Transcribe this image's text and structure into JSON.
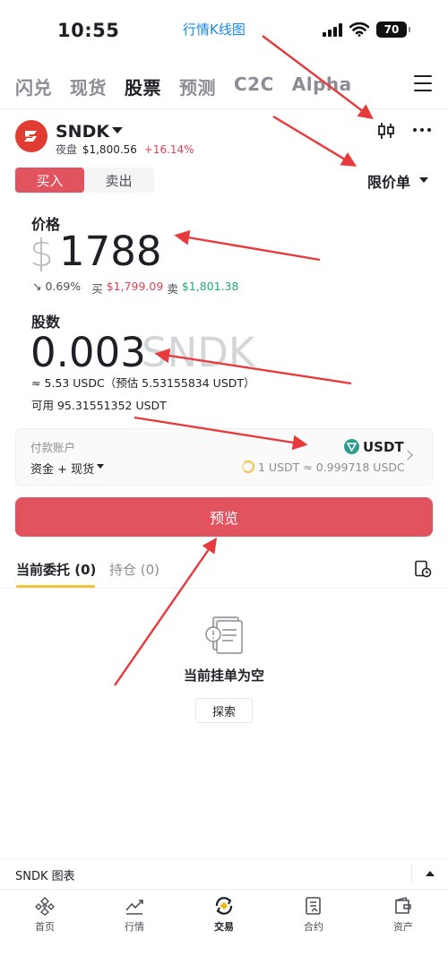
{
  "status": {
    "time": "10:55",
    "battery": "70"
  },
  "annotation": {
    "label": "行情K线图"
  },
  "top_tabs": [
    {
      "label": "闪兑",
      "active": false
    },
    {
      "label": "现货",
      "active": false
    },
    {
      "label": "股票",
      "active": true
    },
    {
      "label": "预测",
      "active": false
    },
    {
      "label": "C2C",
      "active": false
    },
    {
      "label": "Alpha",
      "active": false
    }
  ],
  "symbol": {
    "name": "SNDK",
    "session": "夜盘",
    "price": "$1,800.56",
    "change": "+16.14%"
  },
  "trade": {
    "buy_label": "买入",
    "sell_label": "卖出",
    "order_type": "限价单"
  },
  "price": {
    "label": "价格",
    "currency": "$",
    "value": "1788",
    "pct": "↘ 0.69%",
    "bid_label": "买",
    "bid": "$1,799.09",
    "ask_label": "卖",
    "ask": "$1,801.38"
  },
  "shares": {
    "label": "股数",
    "value": "0.003",
    "unit": "SNDK",
    "estimate": "≈ 5.53 USDC（预估 5.53155834 USDT）",
    "available": "可用 95.31551352 USDT"
  },
  "payment": {
    "label": "付款账户",
    "account": "资金 + 现货",
    "asset": "USDT",
    "rate": "1 USDT ≈ 0.999718 USDC"
  },
  "preview_label": "预览",
  "orders": {
    "tab_open": "当前委托 (0)",
    "tab_positions": "持仓 (0)",
    "empty_text": "当前挂单为空",
    "explore_label": "探索"
  },
  "chart_bar": {
    "label": "SNDK 图表"
  },
  "nav": [
    {
      "label": "首页",
      "icon": "home-icon"
    },
    {
      "label": "行情",
      "icon": "market-icon"
    },
    {
      "label": "交易",
      "icon": "trade-icon"
    },
    {
      "label": "合约",
      "icon": "futures-icon"
    },
    {
      "label": "资产",
      "icon": "wallet-icon"
    }
  ],
  "colors": {
    "buy": "#e0535f",
    "down_red": "#e0424f",
    "up_green": "#25a871",
    "accent_yellow": "#f0c43b",
    "annotation_red": "#e8393c",
    "annotation_blue": "#1a88e8"
  }
}
